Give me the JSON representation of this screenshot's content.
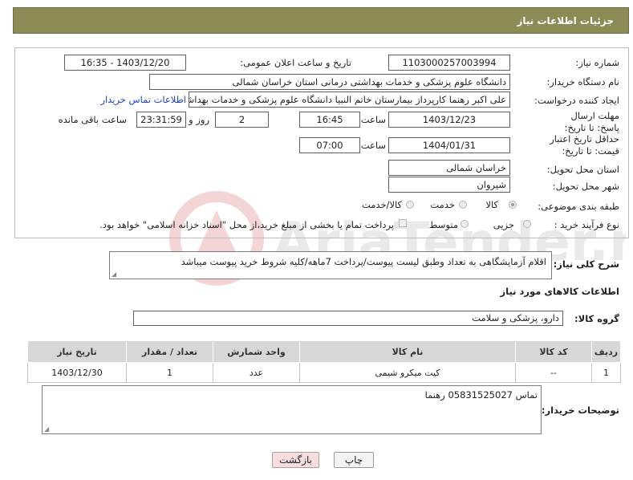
{
  "page": {
    "title": "جزئیات اطلاعات نیاز"
  },
  "form": {
    "need_number_label": "شماره نیاز:",
    "need_number": "1103000257003994",
    "announce_label": "تاریخ و ساعت اعلان عمومی:",
    "announce_value": "1403/12/20 - 16:35",
    "buyer_org_label": "نام دستگاه خریدار:",
    "buyer_org": "دانشگاه علوم پزشکی و خدمات بهداشتی درمانی استان خراسان شمالی",
    "creator_label": "ایجاد کننده درخواست:",
    "creator": "علی اکبر رهنما کارپرداز بیمارستان خاتم النبیا دانشگاه علوم پزشکی و خدمات بهداشتی",
    "contact_link": "اطلاعات تماس خریدار",
    "reply_deadline_label": "مهلت ارسال پاسخ: تا تاریخ:",
    "reply_date": "1403/12/23",
    "time_label": "ساعت",
    "reply_time": "16:45",
    "days_value": "2",
    "days_label": "روز و",
    "remaining_time": "23:31:59",
    "remaining_label": "ساعت باقی مانده",
    "price_validity_label": "حداقل تاریخ اعتبار قیمت: تا تاریخ:",
    "price_date": "1404/01/31",
    "price_time_label": "ساعت",
    "price_time": "07:00",
    "province_label": "استان محل تحویل:",
    "province": "خراسان شمالی",
    "city_label": "شهر محل تحویل:",
    "city": "شیروان",
    "category_label": "طبقه بندی موضوعی:",
    "category_options": [
      "کالا",
      "خدمت",
      "کالا/خدمت"
    ],
    "category_selected": "کالا",
    "process_label": "نوع فرآیند خرید :",
    "process_options": [
      "جزیی",
      "متوسط"
    ],
    "process_note": "پرداخت تمام یا بخشی از مبلغ خرید،از محل \"اسناد خزانه اسلامی\" خواهد بود."
  },
  "description": {
    "label": "شرح کلی نیاز:",
    "text": "اقلام آزمایشگاهی به تعداد وطبق لیست پیوست/پرداخت 7ماهه/کلیه شروط خرید پیوست میباشد"
  },
  "goods": {
    "section_title": "اطلاعات کالاهای مورد نیاز",
    "group_label": "گروه کالا:",
    "group_value": "دارو، پزشکی و سلامت",
    "columns": [
      "ردیف",
      "کد کالا",
      "نام کالا",
      "واحد شمارش",
      "تعداد / مقدار",
      "تاریخ نیاز"
    ],
    "rows": [
      [
        "1",
        "--",
        "کیت میکرو شیمی",
        "عدد",
        "1",
        "1403/12/30"
      ]
    ]
  },
  "buyer_notes": {
    "label": "توضیحات خریدار:",
    "text": "تماس 05831525027 رهنما"
  },
  "buttons": {
    "print": "چاپ",
    "back": "بازگشت"
  },
  "watermark": {
    "text": "AriaTender.net"
  },
  "colors": {
    "header_bg": "#8c8b55",
    "table_header_bg": "#d7d7d7",
    "back_button_bg": "#f7dede"
  }
}
